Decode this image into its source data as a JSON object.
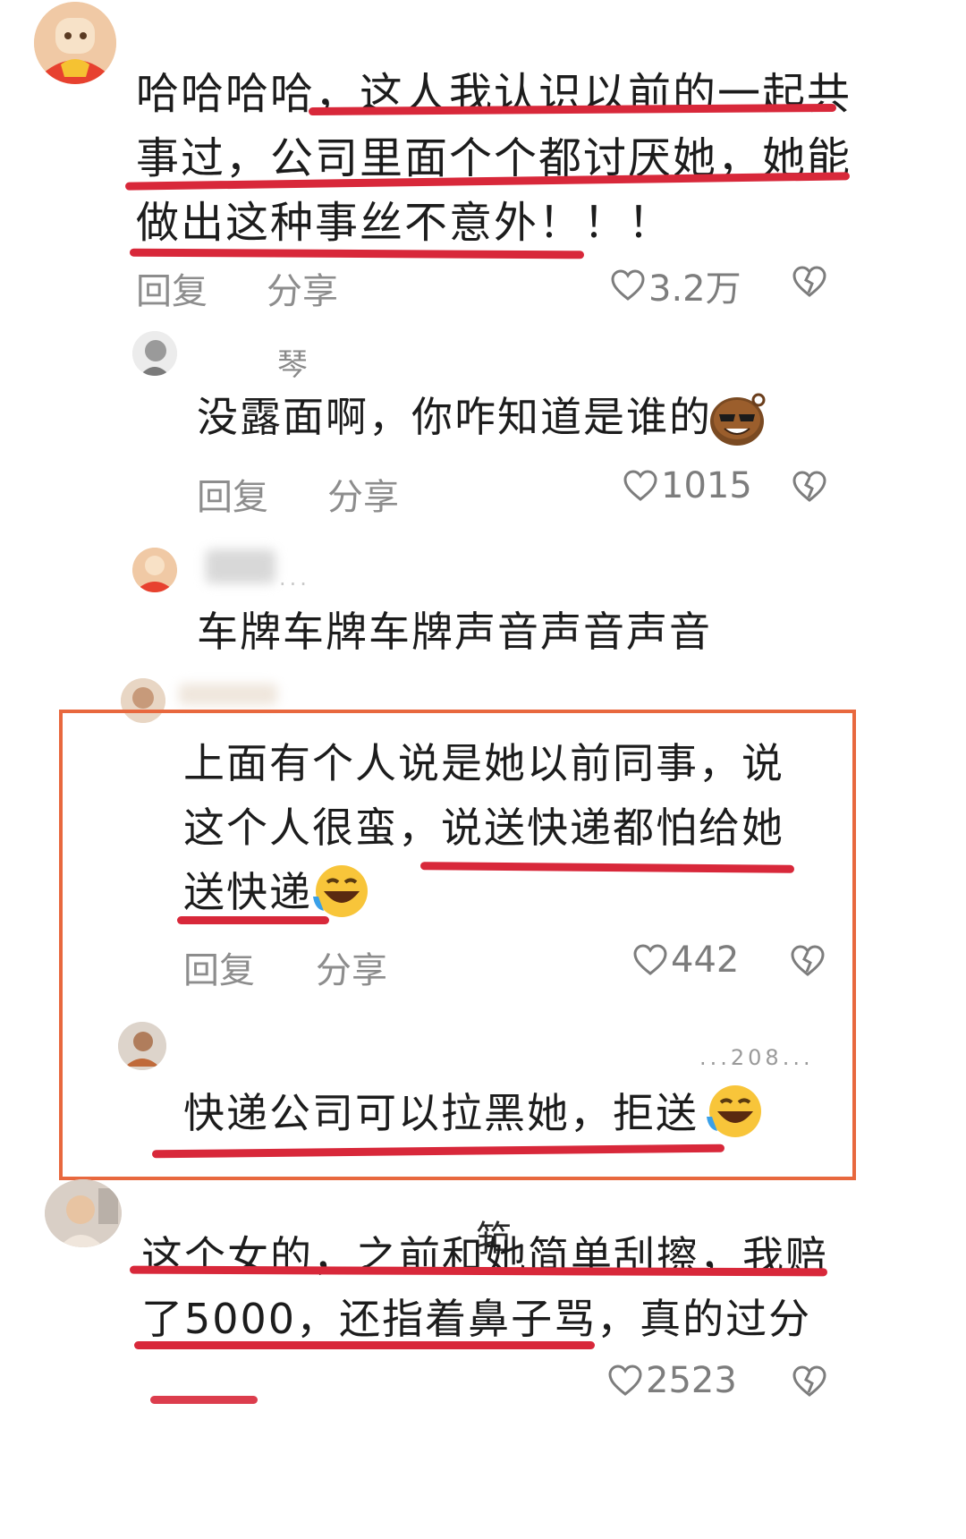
{
  "comments": [
    {
      "lines": [
        "哈哈哈哈，这人我认识以前的一起共",
        "事过，公司里面个个都讨厌她，她能",
        "做出这种事丝不意外！！！"
      ],
      "reply": "回复",
      "share": "分享",
      "likes": "3.2万"
    },
    {
      "username": "琴",
      "lines": [
        "没露面啊，你咋知道是谁的"
      ],
      "reply": "回复",
      "share": "分享",
      "likes": "1015"
    },
    {
      "username_suffix": "...",
      "lines": [
        "车牌车牌车牌声音声音声音"
      ]
    },
    {
      "lines": [
        "上面有个人说是她以前同事，说",
        "这个人很蛮，说送快递都怕给她",
        "送快递"
      ],
      "reply": "回复",
      "share": "分享",
      "likes": "442"
    },
    {
      "username_suffix": "...208...",
      "lines": [
        "快递公司可以拉黑她，拒送"
      ]
    },
    {
      "lines": [
        "这个女的，之前和她简单刮擦，我赔",
        "了5000，还指着鼻子骂，真的过分"
      ],
      "overlay_text": "筘",
      "likes": "2523"
    }
  ],
  "icons": {
    "like": "heart-outline-icon",
    "dislike": "broken-heart-icon",
    "emoji_cool": "cool-face-emoji-icon",
    "emoji_laugh": "laughing-tears-emoji-icon"
  },
  "colors": {
    "underline": "#d8283a",
    "highlight_box": "#e8683e",
    "action_text": "#8d8d8d"
  }
}
